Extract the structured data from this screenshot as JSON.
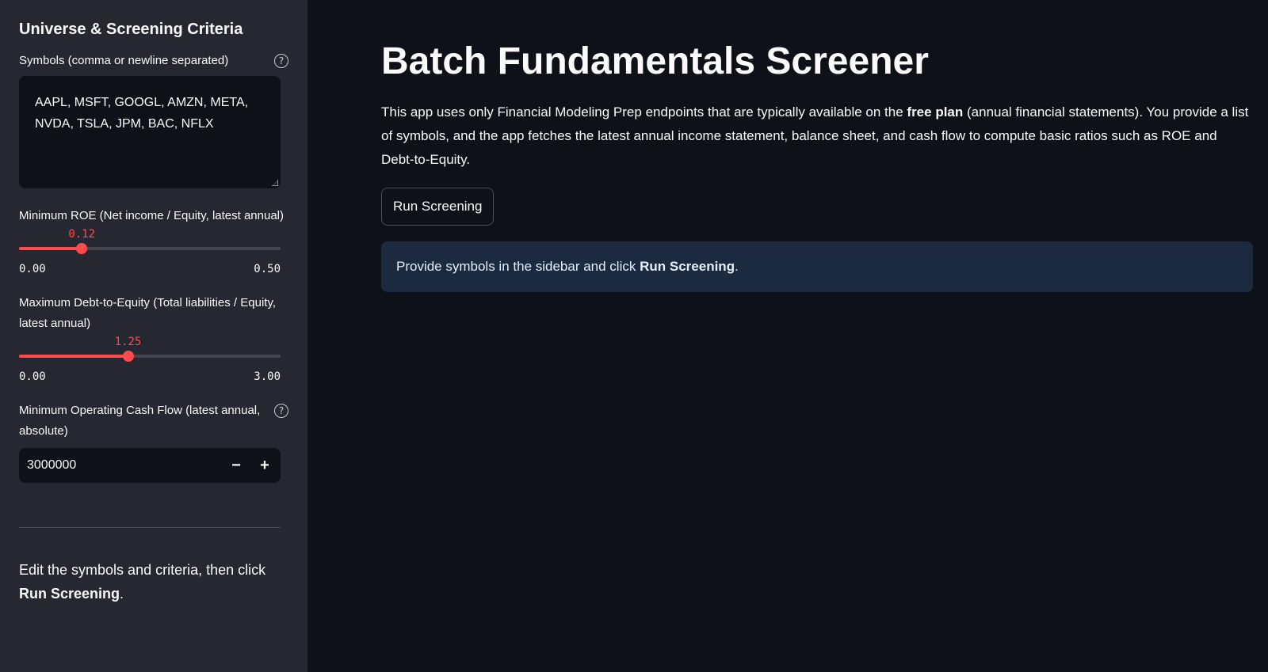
{
  "sidebar": {
    "title": "Universe & Screening Criteria",
    "symbols": {
      "label": "Symbols (comma or newline separated)",
      "help_icon": "question-circle-icon",
      "value": "AAPL, MSFT, GOOGL, AMZN, META, NVDA, TSLA, JPM, BAC, NFLX"
    },
    "min_roe": {
      "label": "Minimum ROE (Net income / Equity, latest annual)",
      "value": "0.12",
      "min": "0.00",
      "max": "0.50",
      "fraction": 0.24
    },
    "max_de": {
      "label": "Maximum Debt-to-Equity (Total liabilities / Equity, latest annual)",
      "value": "1.25",
      "min": "0.00",
      "max": "3.00",
      "fraction": 0.4167
    },
    "min_ocf": {
      "label": "Minimum Operating Cash Flow (latest annual, absolute)",
      "help_icon": "question-circle-icon",
      "value": "3000000",
      "decrement": "−",
      "increment": "+"
    },
    "note_prefix": "Edit the symbols and criteria, then click",
    "note_bold": "Run Screening",
    "note_suffix": "."
  },
  "main": {
    "title": "Batch Fundamentals Screener",
    "intro_part1": "This app uses only Financial Modeling Prep endpoints that are typically available on the",
    "intro_bold": "free plan",
    "intro_part2": "(annual financial statements). You provide a list of symbols, and the app fetches the latest annual income statement, balance sheet, and cash flow to compute basic ratios such as ROE and Debt-to-Equity.",
    "run_button": "Run Screening",
    "info_prefix": "Provide symbols in the sidebar and click",
    "info_bold": "Run Screening",
    "info_suffix": "."
  },
  "colors": {
    "accent": "#ff4b4b",
    "background": "#0e1117",
    "sidebar": "#262730",
    "info_box": "#1c2a3f"
  }
}
